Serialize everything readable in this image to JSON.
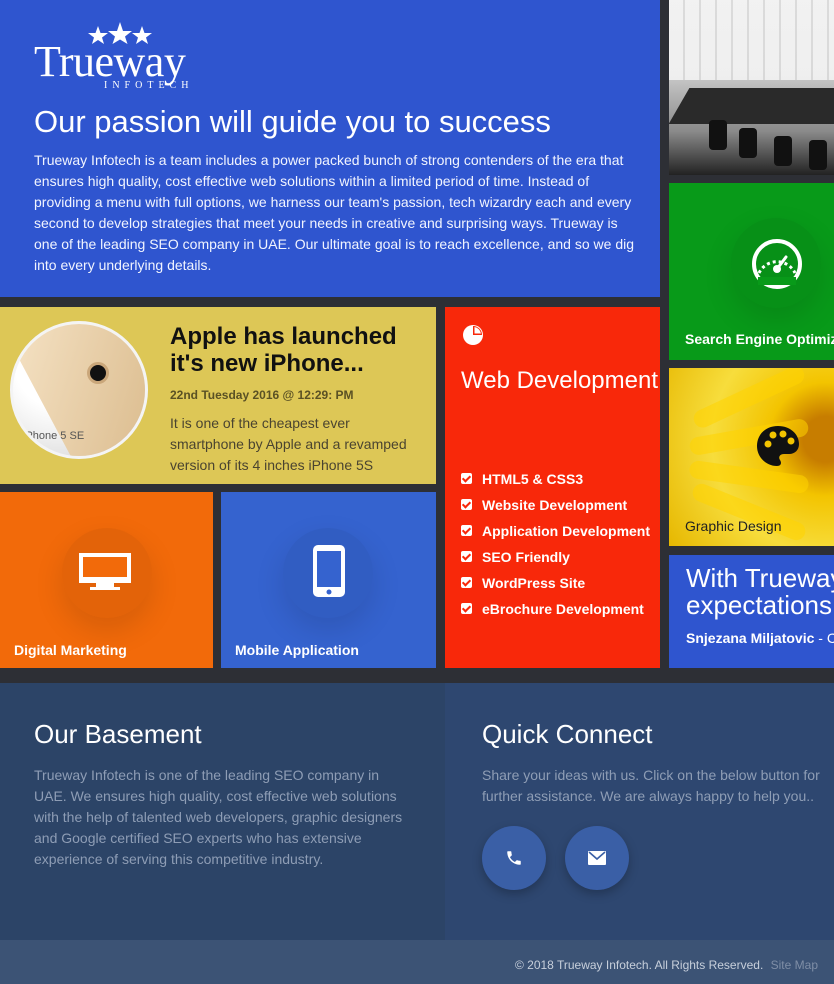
{
  "logo": {
    "name": "Trueway",
    "tagline": "INFOTECH"
  },
  "hero": {
    "title": "Our passion will guide you to success",
    "text": "Trueway Infotech is a team includes a power packed bunch of strong contenders of the era that ensures high quality, cost effective web solutions within a limited period of time. Instead of providing a menu with full options, we harness our team's passion, tech wizardry each and every second to develop strategies that meet your needs in creative and surprising ways. Trueway is one of the leading SEO company in UAE. Our ultimate goal is to reach excellence, and so we dig into every underlying details."
  },
  "tiles": {
    "seo": "Search Engine Optimization",
    "graphic": "Graphic Design",
    "digital": "Digital Marketing",
    "mobile": "Mobile Application"
  },
  "testimonial": {
    "title_line1": "With Trueway",
    "title_line2": "expectations",
    "author": "Snjezana Miljatovic",
    "author_suffix": " - C"
  },
  "news": {
    "title": "Apple has launched it's new iPhone...",
    "date": "22nd Tuesday 2016 @ 12:29: PM",
    "text": "It is one of the cheapest ever smartphone by Apple and a revamped version of its 4 inches iPhone 5S",
    "image_label": "iPhone 5 SE"
  },
  "webdev": {
    "title": "Web Development",
    "items": [
      "HTML5 & CSS3",
      "Website Development",
      "Application Development",
      "SEO Friendly",
      "WordPress Site",
      "eBrochure Development"
    ]
  },
  "basement": {
    "title": "Our Basement",
    "text": "Trueway Infotech is one of the leading SEO company in UAE. We ensures high quality, cost effective web solutions with the help of talented web developers, graphic designers and Google certified SEO experts who has extensive experience of serving this competitive industry."
  },
  "connect": {
    "title": "Quick Connect",
    "text": "Share your ideas with us. Click on the below button for further assistance. We are always happy to help you..",
    "buttons": [
      "phone-icon",
      "mail-icon"
    ]
  },
  "footer": {
    "copyright": "© 2018 Trueway Infotech. All Rights Reserved.",
    "sitemap": "Site Map"
  },
  "colors": {
    "blue": "#2f55cf",
    "green": "#089a19",
    "orange": "#f26a0a",
    "red": "#f8280a",
    "yellow": "#ddc756",
    "navy": "#2c4467"
  }
}
